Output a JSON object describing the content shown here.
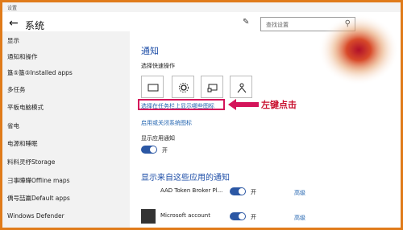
{
  "window": {
    "title": "设置"
  },
  "header": {
    "title": "系统",
    "search_placeholder": "查找设置"
  },
  "sidebar": {
    "items": [
      "显示",
      "通知和操作",
      "簋⑤簋⑤Installed apps",
      "多任务",
      "平板电脑模式",
      "省电",
      "电源和睡眠",
      "料料灵杼Storage",
      "彐事曄曄Offline maps",
      "偊号喆羸Default apps",
      "Windows Defender"
    ]
  },
  "main": {
    "title": "通知",
    "quick_actions_label": "选择快速操作",
    "link_taskbar": "选择在任务栏上显示哪些图标",
    "link_system_icons": "启用或关闭系统图标",
    "show_notifications_label": "显示应用通知",
    "toggle_on": "开",
    "apps_section_title": "显示来自这些应用的通知",
    "apps": [
      {
        "name": "AAD Token Broker Pl...",
        "toggle": "开",
        "advanced": "高级"
      },
      {
        "name": "Microsoft account",
        "toggle": "开",
        "advanced": "高级"
      }
    ]
  },
  "annotation": {
    "text": "左键点击"
  },
  "colors": {
    "accent": "#2b57a4",
    "link": "#2264b0",
    "highlight": "#d4145a",
    "border": "#e07b1a"
  }
}
